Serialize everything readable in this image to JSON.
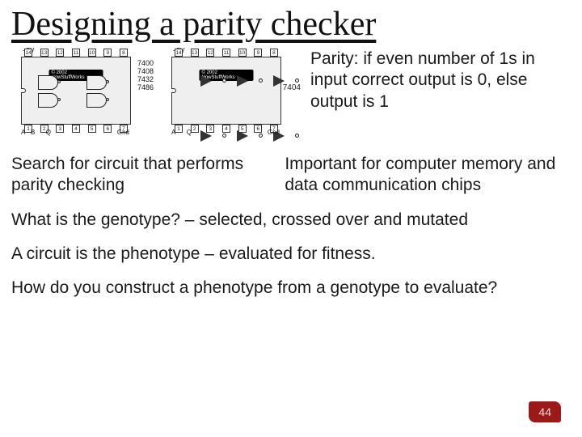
{
  "title": "Designing a parity checker",
  "parity_text": "Parity: if even number of 1s in input correct output is 0, else output is 1",
  "search_text": "Search for circuit that performs parity checking",
  "important_text": "Important for computer memory and data communication chips",
  "genotype_line": "What is the genotype? – selected, crossed over and mutated",
  "phenotype_line": "A circuit is the phenotype – evaluated for fitness.",
  "construct_line": "How do you construct a phenotype from a genotype to evaluate?",
  "page_number": "44",
  "chip_left": {
    "vcc_label": "+5V",
    "watermark": "© 2002 HowStuffWorks",
    "side_list": [
      "7400",
      "7408",
      "7432",
      "7486"
    ],
    "pins_top": [
      "14",
      "13",
      "12",
      "11",
      "10",
      "9",
      "8"
    ],
    "pins_bot": [
      "1",
      "2",
      "3",
      "4",
      "5",
      "6",
      "7"
    ],
    "bottom_left_a": "A",
    "bottom_left_b": "B",
    "bottom_mid": "Q",
    "bottom_right": "Gnd"
  },
  "chip_right": {
    "vcc_label": "+5V",
    "watermark": "© 2002 HowStuffWorks",
    "side_label": "7404",
    "pins_top": [
      "14",
      "13",
      "12",
      "11",
      "10",
      "9",
      "8"
    ],
    "pins_bot": [
      "1",
      "2",
      "3",
      "4",
      "5",
      "6",
      "7"
    ],
    "bottom_left": "A",
    "bottom_mid": "Q",
    "bottom_right": "Gnd"
  }
}
